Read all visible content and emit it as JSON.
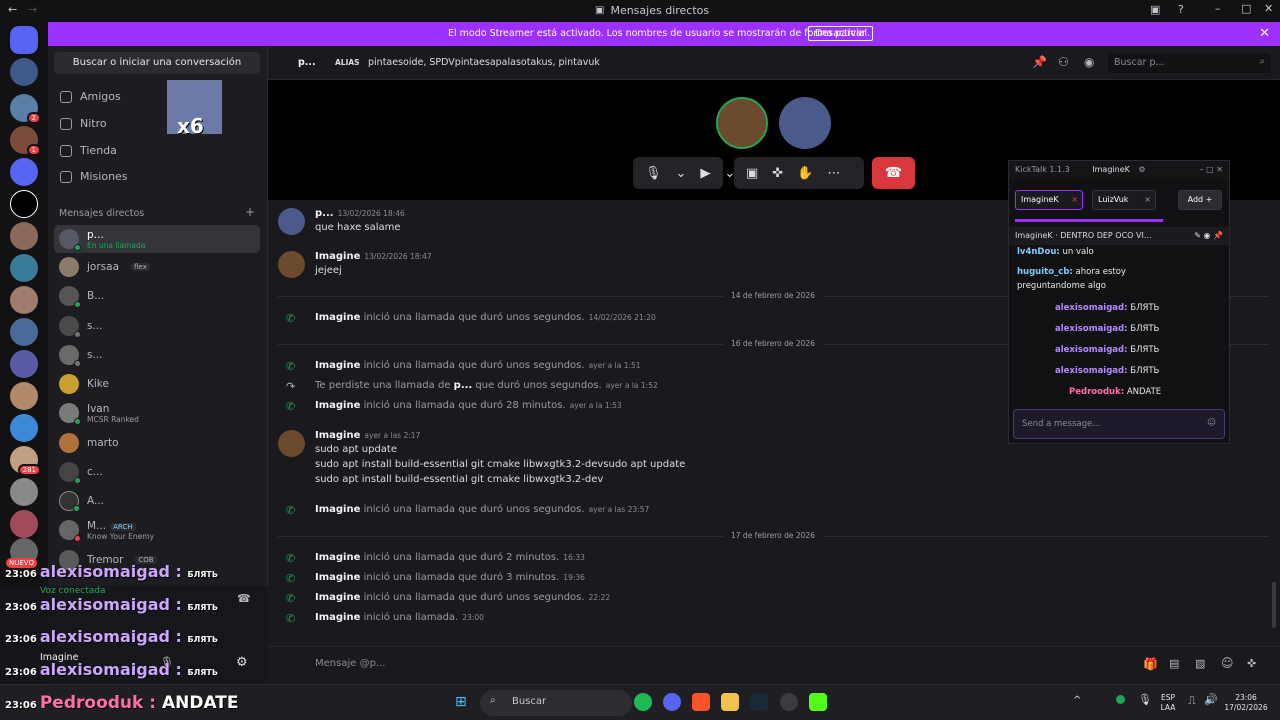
{
  "window": {
    "title": "Mensajes directos"
  },
  "streamer_banner": {
    "message": "El modo Streamer está activado. Los nombres de usuario se mostrarán de forma parcial.",
    "button": "Desactivar"
  },
  "rail": {
    "badges": [
      "2",
      "1",
      "281"
    ],
    "new_label": "NUEVO"
  },
  "sidebar": {
    "search_button": "Buscar o iniciar una conversación",
    "nav": [
      {
        "label": "Amigos",
        "icon": "friends-icon"
      },
      {
        "label": "Nitro",
        "icon": "nitro-icon"
      },
      {
        "label": "Tienda",
        "icon": "shop-icon"
      },
      {
        "label": "Misiones",
        "icon": "quests-icon"
      }
    ],
    "sticker_text": "x6",
    "dm_header": "Mensajes directos",
    "dms": [
      {
        "name": "p...",
        "sub": "En una llamada",
        "tag": ""
      },
      {
        "name": "jorsaa",
        "sub": "",
        "tag": "flex"
      },
      {
        "name": "B...",
        "sub": "",
        "tag": ""
      },
      {
        "name": "s...",
        "sub": "",
        "tag": ""
      },
      {
        "name": "s...",
        "sub": "",
        "tag": ""
      },
      {
        "name": "Kike",
        "sub": "",
        "tag": ""
      },
      {
        "name": "Ivan",
        "sub": "MCSR Ranked",
        "tag": ""
      },
      {
        "name": "marto",
        "sub": "",
        "tag": ""
      },
      {
        "name": "c...",
        "sub": "",
        "tag": ""
      },
      {
        "name": "A...",
        "sub": "",
        "tag": ""
      },
      {
        "name": "M...",
        "sub": "Know Your Enemy",
        "tag": "ARCH"
      },
      {
        "name": "Tremor",
        "sub": "",
        "tag": "COB"
      }
    ],
    "voice_status": "Voz conectada",
    "user_name": "Imagine"
  },
  "header": {
    "name": "p...",
    "alias_label": "ALIAS",
    "aliases": "pintaesoide, SPDVpintaesapalasotakus, pintavuk",
    "search_placeholder": "Buscar p..."
  },
  "chat": {
    "messages": [
      {
        "author": "p...",
        "time": "13/02/2026 18:46",
        "text": "que haxe salame"
      },
      {
        "author": "Imagine",
        "time": "13/02/2026 18:47",
        "text": "jejeej"
      }
    ],
    "dividers": [
      "14 de febrero de 2026",
      "16 de febrero de 2026",
      "17 de febrero de 2026"
    ],
    "calls_14": [
      {
        "author": "Imagine",
        "text": "inició una llamada que duró unos segundos.",
        "time": "14/02/2026 21:20"
      }
    ],
    "calls_16": [
      {
        "author": "Imagine",
        "text": "inició una llamada que duró unos segundos.",
        "time": "ayer a la 1:51"
      },
      {
        "author": "",
        "text": "Te perdiste una llamada de",
        "bold": "p...",
        "text2": "que duró unos segundos.",
        "time": "ayer a la 1:52"
      },
      {
        "author": "Imagine",
        "text": "inició una llamada que duró 28 minutos.",
        "time": "ayer a la 1:53"
      }
    ],
    "code_msg": {
      "author": "Imagine",
      "time": "ayer a las 2:17",
      "lines": [
        "sudo apt update",
        "sudo apt install build-essential git cmake libwxgtk3.2-devsudo apt update",
        "sudo apt install build-essential git cmake libwxgtk3.2-dev"
      ]
    },
    "late_call": {
      "author": "Imagine",
      "text": "inició una llamada que duró unos segundos.",
      "time": "ayer a las 23:57"
    },
    "calls_17": [
      {
        "author": "Imagine",
        "text": "inició una llamada que duró 2 minutos.",
        "time": "16:33"
      },
      {
        "author": "Imagine",
        "text": "inició una llamada que duró 3 minutos.",
        "time": "19:36"
      },
      {
        "author": "Imagine",
        "text": "inició una llamada que duró unos segundos.",
        "time": "22:22"
      },
      {
        "author": "Imagine",
        "text": "inició una llamada.",
        "time": "23:00"
      }
    ],
    "input_placeholder": "Mensaje @p..."
  },
  "kicktalk": {
    "title": "KickTalk 1.1.3",
    "user": "ImagineK",
    "tabs": [
      "ImagineK",
      "LuizVuk"
    ],
    "add_label": "Add",
    "channel": "ImagineK",
    "channel_title": "DENTRO DEP OCO VI...",
    "lines": [
      {
        "user": "lv4nDou:",
        "text": "un valo"
      },
      {
        "user": "huguito_cb:",
        "text": "ahora estoy"
      },
      {
        "user": "",
        "text": "preguntandome algo"
      },
      {
        "user": "alexisomaigad:",
        "text": "БЛЯТЬ"
      },
      {
        "user": "alexisomaigad:",
        "text": "БЛЯТЬ"
      },
      {
        "user": "alexisomaigad:",
        "text": "БЛЯТЬ"
      },
      {
        "user": "alexisomaigad:",
        "text": "БЛЯТЬ"
      },
      {
        "user": "Pedrooduk:",
        "text": "ANDATE"
      }
    ],
    "input_placeholder": "Send a message..."
  },
  "overlay": {
    "lines": [
      {
        "time": "23:06",
        "user": "alexisomaigad :",
        "text": "БЛЯТЬ"
      },
      {
        "time": "23:06",
        "user": "alexisomaigad :",
        "text": "БЛЯТЬ"
      },
      {
        "time": "23:06",
        "user": "alexisomaigad :",
        "text": "БЛЯТЬ"
      },
      {
        "time": "23:06",
        "user": "alexisomaigad :",
        "text": "БЛЯТЬ"
      }
    ],
    "bottom": {
      "time": "23:06",
      "user": "Pedrooduk :",
      "text": "ANDATE"
    }
  },
  "taskbar": {
    "search": "Buscar",
    "lang": "ESP",
    "lang2": "LAA",
    "time": "23:06",
    "date": "17/02/2026"
  },
  "colors": {
    "accent": "#9b30ff",
    "hangup": "#da373c",
    "online": "#23a559"
  }
}
